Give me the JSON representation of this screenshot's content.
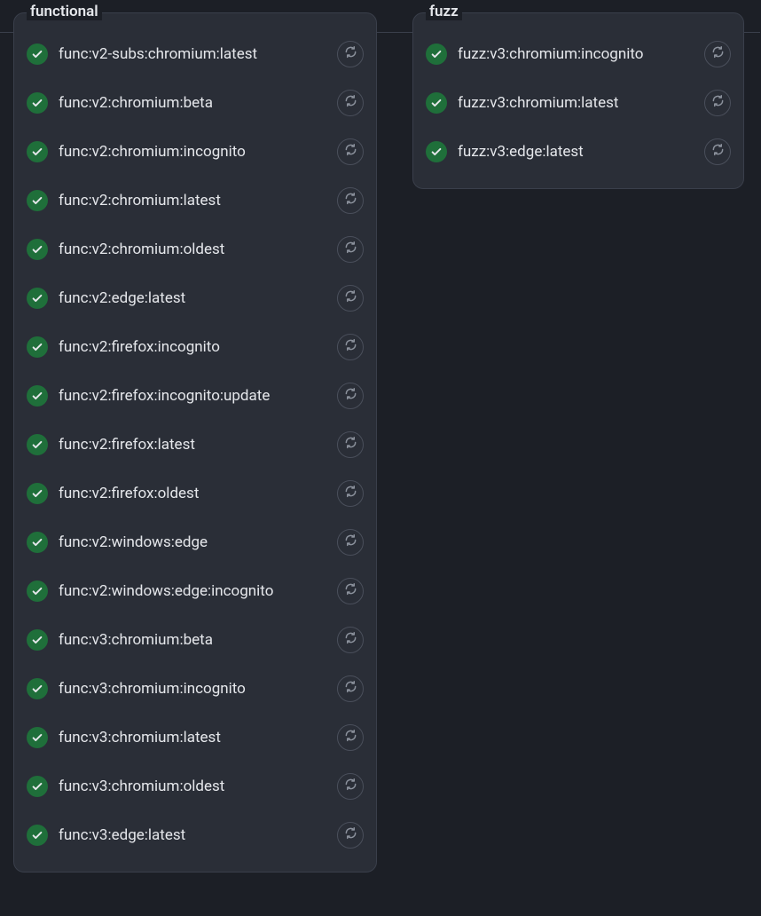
{
  "panels": [
    {
      "id": "functional",
      "title": "functional",
      "jobs": [
        {
          "label": "func:v2-subs:chromium:latest",
          "status": "success"
        },
        {
          "label": "func:v2:chromium:beta",
          "status": "success"
        },
        {
          "label": "func:v2:chromium:incognito",
          "status": "success"
        },
        {
          "label": "func:v2:chromium:latest",
          "status": "success"
        },
        {
          "label": "func:v2:chromium:oldest",
          "status": "success"
        },
        {
          "label": "func:v2:edge:latest",
          "status": "success"
        },
        {
          "label": "func:v2:firefox:incognito",
          "status": "success"
        },
        {
          "label": "func:v2:firefox:incognito:update",
          "status": "success"
        },
        {
          "label": "func:v2:firefox:latest",
          "status": "success"
        },
        {
          "label": "func:v2:firefox:oldest",
          "status": "success"
        },
        {
          "label": "func:v2:windows:edge",
          "status": "success"
        },
        {
          "label": "func:v2:windows:edge:incognito",
          "status": "success"
        },
        {
          "label": "func:v3:chromium:beta",
          "status": "success"
        },
        {
          "label": "func:v3:chromium:incognito",
          "status": "success"
        },
        {
          "label": "func:v3:chromium:latest",
          "status": "success"
        },
        {
          "label": "func:v3:chromium:oldest",
          "status": "success"
        },
        {
          "label": "func:v3:edge:latest",
          "status": "success"
        }
      ]
    },
    {
      "id": "fuzz",
      "title": "fuzz",
      "jobs": [
        {
          "label": "fuzz:v3:chromium:incognito",
          "status": "success"
        },
        {
          "label": "fuzz:v3:chromium:latest",
          "status": "success"
        },
        {
          "label": "fuzz:v3:edge:latest",
          "status": "success"
        }
      ]
    }
  ]
}
